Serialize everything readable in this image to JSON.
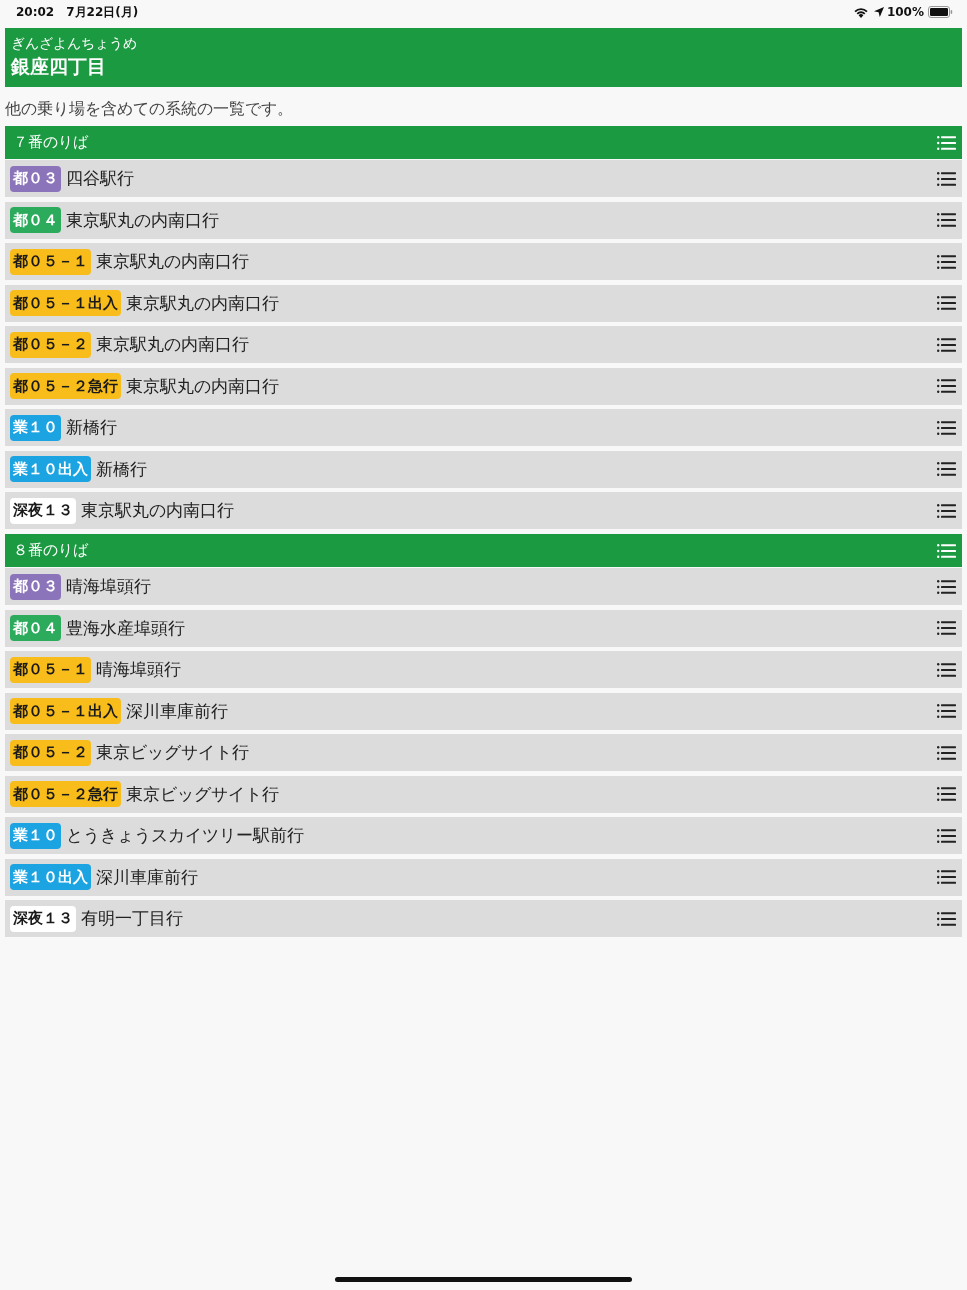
{
  "status_bar": {
    "time": "20:02",
    "date": "7月22日(月)",
    "battery": "100%"
  },
  "station": {
    "reading": "ぎんざよんちょうめ",
    "name": "銀座四丁目"
  },
  "description": "他の乗り場を含めての系統の一覧です。",
  "platforms": [
    {
      "title": "７番のりば",
      "routes": [
        {
          "route": "都０３",
          "color": "#8b74b9",
          "destination": "四谷駅行"
        },
        {
          "route": "都０４",
          "color": "#2cab5d",
          "destination": "東京駅丸の内南口行"
        },
        {
          "route": "都０５－１",
          "color": "#f9bd1b",
          "destination": "東京駅丸の内南口行"
        },
        {
          "route": "都０５－１出入",
          "color": "#f9bd1b",
          "destination": "東京駅丸の内南口行"
        },
        {
          "route": "都０５－２",
          "color": "#f9bd1b",
          "destination": "東京駅丸の内南口行"
        },
        {
          "route": "都０５－２急行",
          "color": "#f9bd1b",
          "destination": "東京駅丸の内南口行"
        },
        {
          "route": "業１０",
          "color": "#1ba4e1",
          "destination": "新橋行"
        },
        {
          "route": "業１０出入",
          "color": "#1ba4e1",
          "destination": "新橋行"
        },
        {
          "route": "深夜１３",
          "color": "#ffffff",
          "destination": "東京駅丸の内南口行"
        }
      ]
    },
    {
      "title": "８番のりば",
      "routes": [
        {
          "route": "都０３",
          "color": "#8b74b9",
          "destination": "晴海埠頭行"
        },
        {
          "route": "都０４",
          "color": "#2cab5d",
          "destination": "豊海水産埠頭行"
        },
        {
          "route": "都０５－１",
          "color": "#f9bd1b",
          "destination": "晴海埠頭行"
        },
        {
          "route": "都０５－１出入",
          "color": "#f9bd1b",
          "destination": "深川車庫前行"
        },
        {
          "route": "都０５－２",
          "color": "#f9bd1b",
          "destination": "東京ビッグサイト行"
        },
        {
          "route": "都０５－２急行",
          "color": "#f9bd1b",
          "destination": "東京ビッグサイト行"
        },
        {
          "route": "業１０",
          "color": "#1ba4e1",
          "destination": "とうきょうスカイツリー駅前行"
        },
        {
          "route": "業１０出入",
          "color": "#1ba4e1",
          "destination": "深川車庫前行"
        },
        {
          "route": "深夜１３",
          "color": "#ffffff",
          "destination": "有明一丁目行"
        }
      ]
    }
  ]
}
